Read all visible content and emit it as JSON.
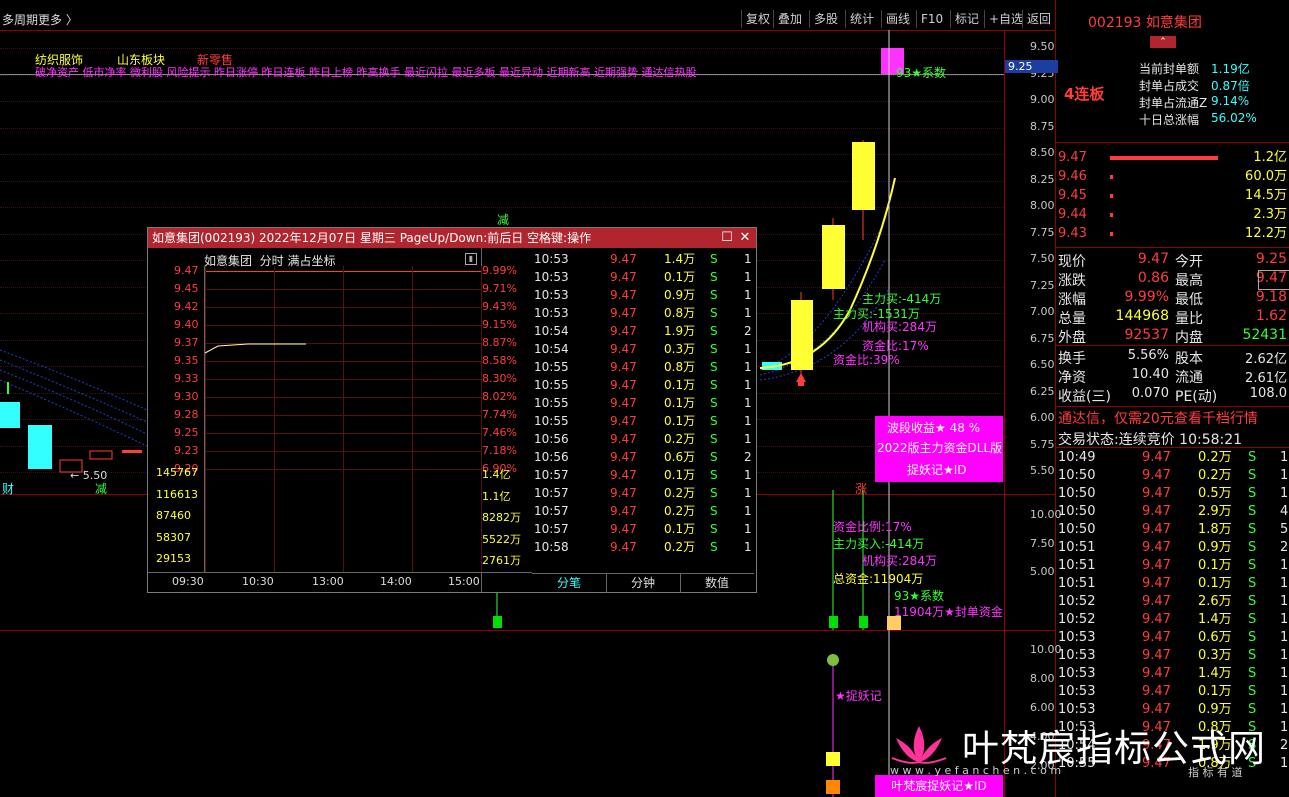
{
  "topbar": {
    "left_items": [
      "多周期",
      "更多 〉"
    ],
    "right_buttons": [
      "复权",
      "叠加",
      "多股",
      "统计",
      "画线",
      "F10",
      "标记",
      "+自选",
      "返回"
    ]
  },
  "stock": {
    "code_name": "002193 如意集团",
    "streak": "4连板",
    "seal_stats": [
      {
        "label": "当前封单额",
        "value": "1.19亿"
      },
      {
        "label": "封单占成交",
        "value": "0.87倍"
      },
      {
        "label": "封单占流通Z",
        "value": "9.14%"
      },
      {
        "label": "十日总涨幅",
        "value": "56.02%"
      }
    ]
  },
  "sectors": {
    "tags": [
      "纺织服饰",
      "山东板块",
      "新零售"
    ],
    "concept_line": "破净资产 低市净率 微利股 风险提示 昨日涨停 昨日连板 昨日上榜 昨高换手 最近闪拉 最近多板 最近异动 近期新高 近期强势 通达信热股"
  },
  "main_chart": {
    "y_ticks": [
      "9.50",
      "9.25",
      "9.00",
      "8.75",
      "8.50",
      "8.25",
      "8.00",
      "7.75",
      "7.50",
      "7.25",
      "7.00",
      "6.75",
      "6.50",
      "6.25",
      "6.00",
      "5.75",
      "5.50"
    ],
    "current_price_tag": "9.25",
    "low_label": "← 5.50",
    "marks": [
      "财",
      "减",
      "减",
      "涨"
    ],
    "top_annotation": "93★系数",
    "annotations": [
      "主力买:-414万",
      "主力买:-1531万",
      "机构买:284万",
      "资金比:17%",
      "资金比:39%"
    ],
    "panel_box": [
      "波段收益★ 48  %",
      "2022版主力资金DLL版",
      "捉妖记★ID"
    ]
  },
  "sub_chart1": {
    "y_ticks": [
      "10.00",
      "7.50",
      "5.00"
    ],
    "annotations": [
      "资金比例:17%",
      "主力买入:-414万",
      "机构买:284万",
      "总资金:11904万",
      "93★系数",
      "11904万★封单资金"
    ]
  },
  "sub_chart2": {
    "y_ticks": [
      "10.00",
      "8.00",
      "6.00",
      "4.00",
      "2.00"
    ],
    "annotations": [
      "★捉妖记"
    ],
    "bottom_box": "叶梵宸捉妖记★ID"
  },
  "popup": {
    "title": "如意集团(002193) 2022年12月07日 星期三 PageUp/Down:前后日 空格键:操作",
    "subtitle": [
      "如意集团",
      "分时",
      "满占坐标"
    ],
    "left_ticks": [
      "9.47",
      "9.45",
      "9.42",
      "9.40",
      "9.37",
      "9.35",
      "9.33",
      "9.30",
      "9.28",
      "9.25",
      "9.23",
      "9.20"
    ],
    "right_ticks": [
      "9.99%",
      "9.71%",
      "9.43%",
      "9.15%",
      "8.87%",
      "8.58%",
      "8.30%",
      "8.02%",
      "7.74%",
      "7.46%",
      "7.18%",
      "6.90%"
    ],
    "vol_left": [
      "145767",
      "116613",
      "87460",
      "58307",
      "29153"
    ],
    "vol_right": [
      "1.4亿",
      "1.1亿",
      "8282万",
      "5522万",
      "2761万"
    ],
    "x_ticks": [
      "09:30",
      "10:30",
      "13:00",
      "14:00",
      "15:00"
    ],
    "ticks": [
      [
        "10:53",
        "9.47",
        "1.4万",
        "S",
        "1"
      ],
      [
        "10:53",
        "9.47",
        "0.1万",
        "S",
        "1"
      ],
      [
        "10:53",
        "9.47",
        "0.9万",
        "S",
        "1"
      ],
      [
        "10:53",
        "9.47",
        "0.8万",
        "S",
        "1"
      ],
      [
        "10:54",
        "9.47",
        "1.9万",
        "S",
        "2"
      ],
      [
        "10:54",
        "9.47",
        "0.3万",
        "S",
        "1"
      ],
      [
        "10:55",
        "9.47",
        "0.8万",
        "S",
        "1"
      ],
      [
        "10:55",
        "9.47",
        "0.1万",
        "S",
        "1"
      ],
      [
        "10:55",
        "9.47",
        "0.1万",
        "S",
        "1"
      ],
      [
        "10:55",
        "9.47",
        "0.1万",
        "S",
        "1"
      ],
      [
        "10:56",
        "9.47",
        "0.2万",
        "S",
        "1"
      ],
      [
        "10:56",
        "9.47",
        "0.6万",
        "S",
        "2"
      ],
      [
        "10:57",
        "9.47",
        "0.1万",
        "S",
        "1"
      ],
      [
        "10:57",
        "9.47",
        "0.2万",
        "S",
        "1"
      ],
      [
        "10:57",
        "9.47",
        "0.2万",
        "S",
        "1"
      ],
      [
        "10:57",
        "9.47",
        "0.1万",
        "S",
        "1"
      ],
      [
        "10:58",
        "9.47",
        "0.2万",
        "S",
        "1"
      ]
    ],
    "tabs": [
      "分笔",
      "分钟",
      "数值"
    ]
  },
  "orderbook": [
    {
      "price": "9.47",
      "vol": "1.2亿",
      "bar": 1.0
    },
    {
      "price": "9.46",
      "vol": "60.0万",
      "bar": 0.02
    },
    {
      "price": "9.45",
      "vol": "14.5万",
      "bar": 0.02
    },
    {
      "price": "9.44",
      "vol": "2.3万",
      "bar": 0.02
    },
    {
      "price": "9.43",
      "vol": "12.2万",
      "bar": 0.02
    }
  ],
  "quote": [
    [
      {
        "label": "现价",
        "value": "9.47",
        "c": "red"
      },
      {
        "label": "今开",
        "value": "9.25",
        "c": "red"
      }
    ],
    [
      {
        "label": "涨跌",
        "value": "0.86",
        "c": "red"
      },
      {
        "label": "最高",
        "value": "9.47",
        "c": "red"
      }
    ],
    [
      {
        "label": "涨幅",
        "value": "9.99%",
        "c": "red"
      },
      {
        "label": "最低",
        "value": "9.18",
        "c": "red"
      }
    ],
    [
      {
        "label": "总量",
        "value": "144968",
        "c": "yel"
      },
      {
        "label": "量比",
        "value": "1.62",
        "c": "red"
      }
    ],
    [
      {
        "label": "外盘",
        "value": "92537",
        "c": "red"
      },
      {
        "label": "内盘",
        "value": "52431",
        "c": "grn"
      }
    ]
  ],
  "fundamentals": [
    [
      {
        "label": "换手",
        "value": "5.56%"
      },
      {
        "label": "股本",
        "value": "2.62亿"
      }
    ],
    [
      {
        "label": "净资",
        "value": "10.40"
      },
      {
        "label": "流通",
        "value": "2.61亿"
      }
    ],
    [
      {
        "label": "收益(三)",
        "value": "0.070"
      },
      {
        "label": "PE(动)",
        "value": "108.0"
      }
    ]
  ],
  "promo": "通达信，仅需20元查看千档行情",
  "trade_status": {
    "label": "交易状态:",
    "value": "连续竞价",
    "time": "10:58:21"
  },
  "right_ticks": [
    [
      "10:49",
      "9.47",
      "0.2万",
      "S",
      "1"
    ],
    [
      "10:50",
      "9.47",
      "0.2万",
      "S",
      "1"
    ],
    [
      "10:50",
      "9.47",
      "0.5万",
      "S",
      "1"
    ],
    [
      "10:50",
      "9.47",
      "2.9万",
      "S",
      "4"
    ],
    [
      "10:50",
      "9.47",
      "1.8万",
      "S",
      "5"
    ],
    [
      "10:51",
      "9.47",
      "0.9万",
      "S",
      "2"
    ],
    [
      "10:51",
      "9.47",
      "0.1万",
      "S",
      "1"
    ],
    [
      "10:51",
      "9.47",
      "0.1万",
      "S",
      "1"
    ],
    [
      "10:52",
      "9.47",
      "2.6万",
      "S",
      "1"
    ],
    [
      "10:52",
      "9.47",
      "1.4万",
      "S",
      "1"
    ],
    [
      "10:53",
      "9.47",
      "0.6万",
      "S",
      "1"
    ],
    [
      "10:53",
      "9.47",
      "0.3万",
      "S",
      "1"
    ],
    [
      "10:53",
      "9.47",
      "1.4万",
      "S",
      "1"
    ],
    [
      "10:53",
      "9.47",
      "0.1万",
      "S",
      "1"
    ],
    [
      "10:53",
      "9.47",
      "0.9万",
      "S",
      "1"
    ],
    [
      "10:53",
      "9.47",
      "0.8万",
      "S",
      "1"
    ],
    [
      "10:54",
      "9.47",
      "1.9万",
      "S",
      "2"
    ],
    [
      "10:55",
      "9.47",
      "0.8万",
      "S",
      "1"
    ]
  ],
  "watermark": {
    "brand": "叶梵宸指标公式网",
    "url": "w w w . y e f a n c h e n . c o m",
    "tagline": "指 标 有 道"
  }
}
